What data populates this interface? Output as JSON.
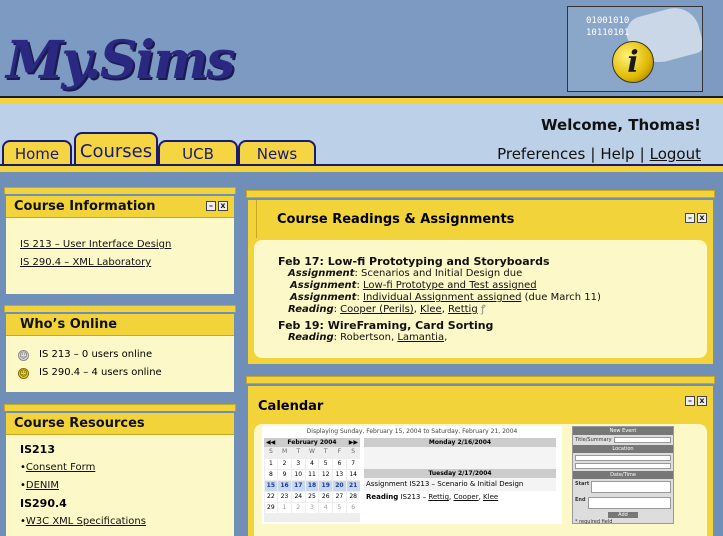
{
  "header": {
    "logo_text": "My.Sims",
    "logo_bits": "01001010\n10110101"
  },
  "tabs": [
    {
      "label": "Home"
    },
    {
      "label": "Courses"
    },
    {
      "label": "UCB"
    },
    {
      "label": "News"
    }
  ],
  "user": {
    "welcome": "Welcome, Thomas!",
    "preferences": "Preferences",
    "help": "Help",
    "logout": "Logout",
    "sep": "|"
  },
  "course_info": {
    "title": "Course Information",
    "links": [
      "IS 213 – User Interface Design",
      "IS 290.4 – XML Laboratory"
    ]
  },
  "whos_online": {
    "title": "Who’s Online",
    "items": [
      "IS 213 – 0 users online",
      "IS 290.4 – 4 users online"
    ]
  },
  "resources": {
    "title": "Course Resources",
    "groups": [
      {
        "name": "IS213",
        "links": [
          "Consent Form",
          "DENIM"
        ]
      },
      {
        "name": "IS290.4",
        "links": [
          "W3C XML Specifications"
        ]
      }
    ]
  },
  "readings": {
    "title": "Course Readings & Assignments",
    "feb17_date": "Feb 17",
    "feb17_topic": ": Low-fi Prototyping and Storyboards",
    "a1_label": "Assignment",
    "a1_text": ": Scenarios and Initial Design due",
    "a2_label": "Assignment",
    "a2_text": ": ",
    "a2_link": "Low-fi Prototype and Test assigned",
    "a3_label": "Assignment",
    "a3_text": ": ",
    "a3_link": "Individual Assignment assigned",
    "a3_suffix": " (due March 11)",
    "r1_label": "Reading",
    "r1_text": ": ",
    "r1_links": [
      "Cooper (Perils)",
      "Klee",
      "Rettig"
    ],
    "feb19_date": "Feb 19",
    "feb19_topic": ": WireFraming, Card Sorting",
    "r2_label": "Reading",
    "r2_text": ": Robertson, ",
    "r2_link": "Lamantia",
    "r2_suffix": ","
  },
  "calendar": {
    "title": "Calendar",
    "range": "Displaying Sunday, February 15, 2004 to Saturday, February 21, 2004",
    "month": "February 2004",
    "dow": [
      "S",
      "M",
      "T",
      "W",
      "T",
      "F",
      "S"
    ],
    "weeks": [
      [
        "",
        "",
        "",
        "",
        "",
        "",
        ""
      ],
      [
        "1",
        "2",
        "3",
        "4",
        "5",
        "6",
        "7"
      ],
      [
        "8",
        "9",
        "10",
        "11",
        "12",
        "13",
        "14"
      ],
      [
        "15",
        "16",
        "17",
        "18",
        "19",
        "20",
        "21"
      ],
      [
        "22",
        "23",
        "24",
        "25",
        "26",
        "27",
        "28"
      ],
      [
        "29",
        "1",
        "2",
        "3",
        "4",
        "5",
        "6"
      ]
    ],
    "monday": "Monday 2/16/2004",
    "tuesday": "Tuesday 2/17/2004",
    "tue_item": "Assignment IS213 – Scenario & Initial Design",
    "tue_reading_label": "Reading",
    "tue_reading_text": " IS213 – ",
    "tue_reading_links": [
      "Rettig",
      "Cooper",
      "Klee"
    ],
    "new_event": {
      "title": "New Event",
      "summary": "Title/Summary",
      "location": "Location",
      "datetime": "Date/Time",
      "start": "Start",
      "end": "End",
      "add": "Add",
      "required": "* required field"
    }
  },
  "colors": {
    "gold": "#f2d43a",
    "panel": "#fdf8c8",
    "navy": "#1a1a70",
    "sky": "#6f8fb8"
  }
}
